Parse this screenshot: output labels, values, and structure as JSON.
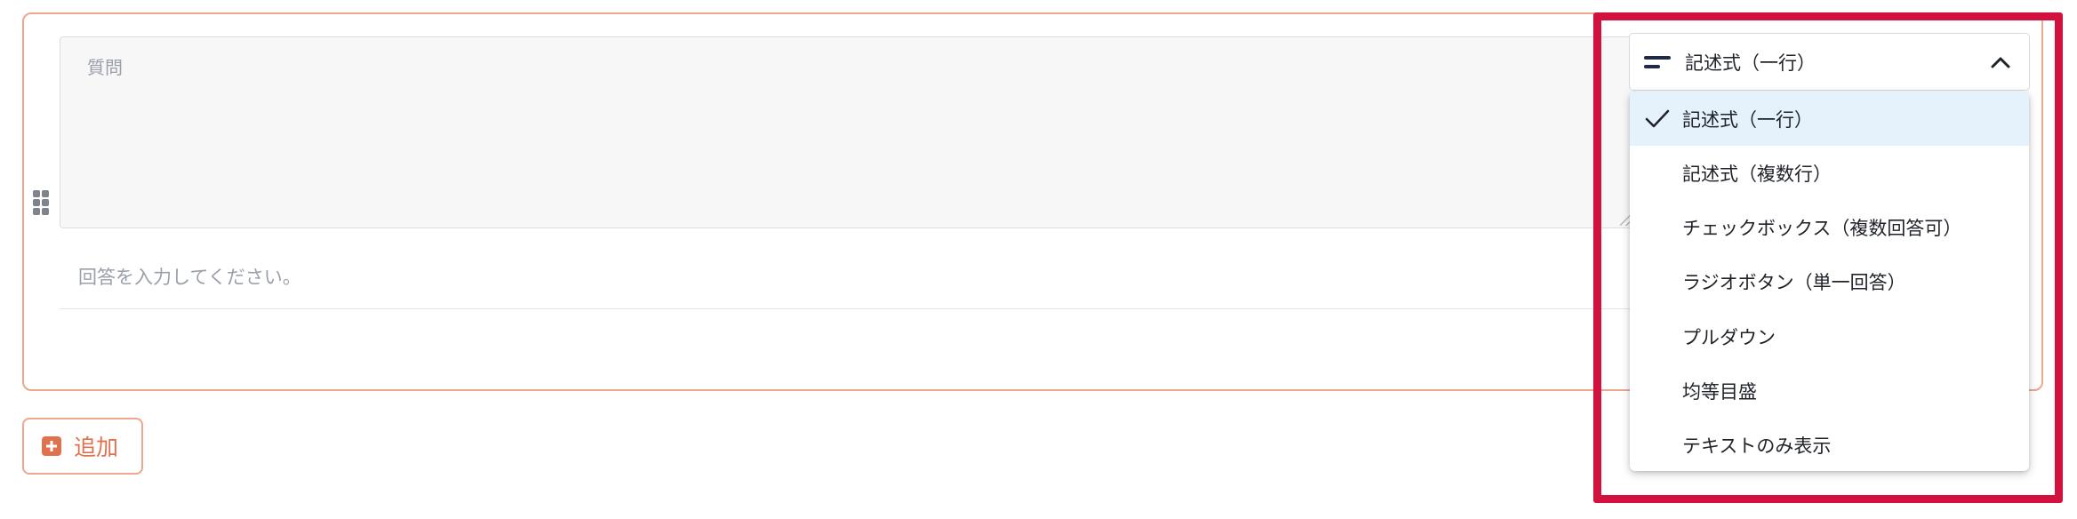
{
  "question_card": {
    "question_placeholder": "質問",
    "answer_hint": "回答を入力してください。"
  },
  "add_button": {
    "label": "追加"
  },
  "type_select": {
    "selected_label": "記述式（一行）",
    "icon": "short-text-icon",
    "state": "open"
  },
  "menu": {
    "items": [
      {
        "label": "記述式（一行）",
        "selected": true
      },
      {
        "label": "記述式（複数行）",
        "selected": false
      },
      {
        "label": "チェックボックス（複数回答可）",
        "selected": false
      },
      {
        "label": "ラジオボタン（単一回答）",
        "selected": false
      },
      {
        "label": "プルダウン",
        "selected": false
      },
      {
        "label": "均等目盛",
        "selected": false
      },
      {
        "label": "テキストのみ表示",
        "selected": false
      }
    ]
  },
  "colors": {
    "accent": "#e0714f",
    "highlight": "#d3113f",
    "selected_bg": "#e5f1fb"
  }
}
